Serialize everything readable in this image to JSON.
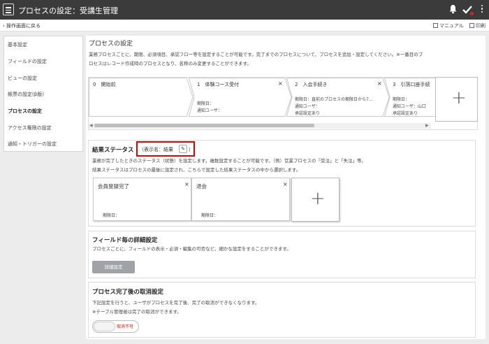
{
  "topbar": {
    "title": "プロセスの設定：受講生管理"
  },
  "subbar": {
    "back_label": "操作画面に戻る",
    "manual_label": "マニュアル",
    "print_label": "印刷"
  },
  "sidebar": {
    "items": [
      {
        "label": "基本設定"
      },
      {
        "label": "フィールドの設定"
      },
      {
        "label": "ビューの設定"
      },
      {
        "label": "帳票の設定(β版)"
      },
      {
        "label": "プロセスの設定",
        "active": true
      },
      {
        "label": "アクセス権限の設定"
      },
      {
        "label": "通知・トリガーの設定"
      }
    ]
  },
  "process": {
    "title": "プロセスの設定",
    "desc1": "業務プロセスごとに、期限、必須項目、承認フロー等を設定することが可能です。完了までのプロセスについて、プロセスを追加・設定してください。※一番目のプ",
    "desc2": "ロセスはレコード作成時のプロセスとなり、名称のみ変更することができます。",
    "cards": [
      {
        "title": "0　開始前"
      },
      {
        "title": "1　体験コース受付",
        "close": "×",
        "l1": "期限日：",
        "l2": "通知ユーザ："
      },
      {
        "title": "2　入会手続き",
        "close": "×",
        "l1": "期限日：直前のプロセスの期限日から7…",
        "l2": "通知ユーザ：",
        "l3": "承認設定あり"
      },
      {
        "title": "3　引落口座手続",
        "l1": "期限日：",
        "l2": "通知ユーザ：山口",
        "l3": "承認設定あり"
      }
    ],
    "add": "+"
  },
  "result": {
    "title": "結果ステータス",
    "display_name": "（表示名：結果",
    "display_close": "）",
    "desc1": "業務が完了したときのステータス（状態）を設定します。複数設定することが可能です。（例）営業プロセスの「受注」と「失注」等。",
    "desc2": "結果ステータスはプロセスの最後に設定され、こちらで設定した結果ステータスの中から選択します。",
    "cards": [
      {
        "title": "会員登録完了",
        "close": "×",
        "due": "期限日："
      },
      {
        "title": "退会",
        "close": "×",
        "due": "期限日："
      }
    ],
    "add": "+"
  },
  "field": {
    "title": "フィールド毎の詳細設定",
    "desc": "プロセスごとに、フィールドの表示・必須・編集の可否など、細かな設定をすることができます。",
    "button": "詳細設定"
  },
  "cancel": {
    "title": "プロセス完了後の取消設定",
    "desc1": "下記設定を行うと、ユーザがプロセスを完了後、完了の取消ができなくなります。",
    "desc2": "※テーブル管理者は完了の取消ができます。",
    "toggle_label": "取消不可"
  }
}
